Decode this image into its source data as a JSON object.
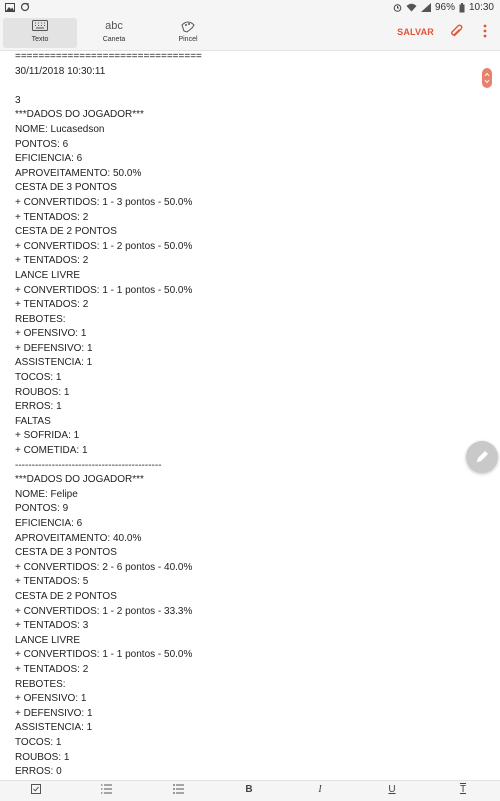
{
  "status_bar": {
    "battery": "96%",
    "time": "10:30"
  },
  "toolbar": {
    "tools": [
      {
        "label": "Texto",
        "icon": "keyboard-icon"
      },
      {
        "label": "Caneta",
        "icon": "pen-abc-icon",
        "glyph": "abc"
      },
      {
        "label": "Pincel",
        "icon": "brush-icon"
      }
    ],
    "save_label": "SALVAR"
  },
  "document": {
    "lines": [
      "================================",
      "30/11/2018 10:30:11",
      "",
      "3",
      "***DADOS DO JOGADOR***",
      "NOME: Lucasedson",
      "PONTOS: 6",
      "EFICIENCIA: 6",
      "APROVEITAMENTO: 50.0%",
      "CESTA DE 3 PONTOS",
      "+ CONVERTIDOS: 1 - 3 pontos - 50.0%",
      "+ TENTADOS: 2",
      "CESTA DE 2 PONTOS",
      "+ CONVERTIDOS: 1 - 2 pontos - 50.0%",
      "+ TENTADOS: 2",
      "LANCE LIVRE",
      "+ CONVERTIDOS: 1 - 1 pontos - 50.0%",
      "+ TENTADOS: 2",
      "REBOTES:",
      "+ OFENSIVO: 1",
      "+ DEFENSIVO: 1",
      "ASSISTENCIA: 1",
      "TOCOS: 1",
      "ROUBOS: 1",
      "ERROS: 1",
      "FALTAS",
      "+ SOFRIDA: 1",
      "+ COMETIDA: 1",
      "--------------------------------------------",
      "***DADOS DO JOGADOR***",
      "NOME: Felipe",
      "PONTOS: 9",
      "EFICIENCIA: 6",
      "APROVEITAMENTO: 40.0%",
      "CESTA DE 3 PONTOS",
      "+ CONVERTIDOS: 2 - 6 pontos - 40.0%",
      "+ TENTADOS: 5",
      "CESTA DE 2 PONTOS",
      "+ CONVERTIDOS: 1 - 2 pontos - 33.3%",
      "+ TENTADOS: 3",
      "LANCE LIVRE",
      "+ CONVERTIDOS: 1 - 1 pontos - 50.0%",
      "+ TENTADOS: 2",
      "REBOTES:",
      "+ OFENSIVO: 1",
      "+ DEFENSIVO: 1",
      "ASSISTENCIA: 1",
      "TOCOS: 1",
      "ROUBOS: 1",
      "ERROS: 0"
    ]
  },
  "format_bar": {
    "bold": "B",
    "italic": "I",
    "underline": "U",
    "strike": "T"
  },
  "colors": {
    "accent": "#e0553a"
  }
}
